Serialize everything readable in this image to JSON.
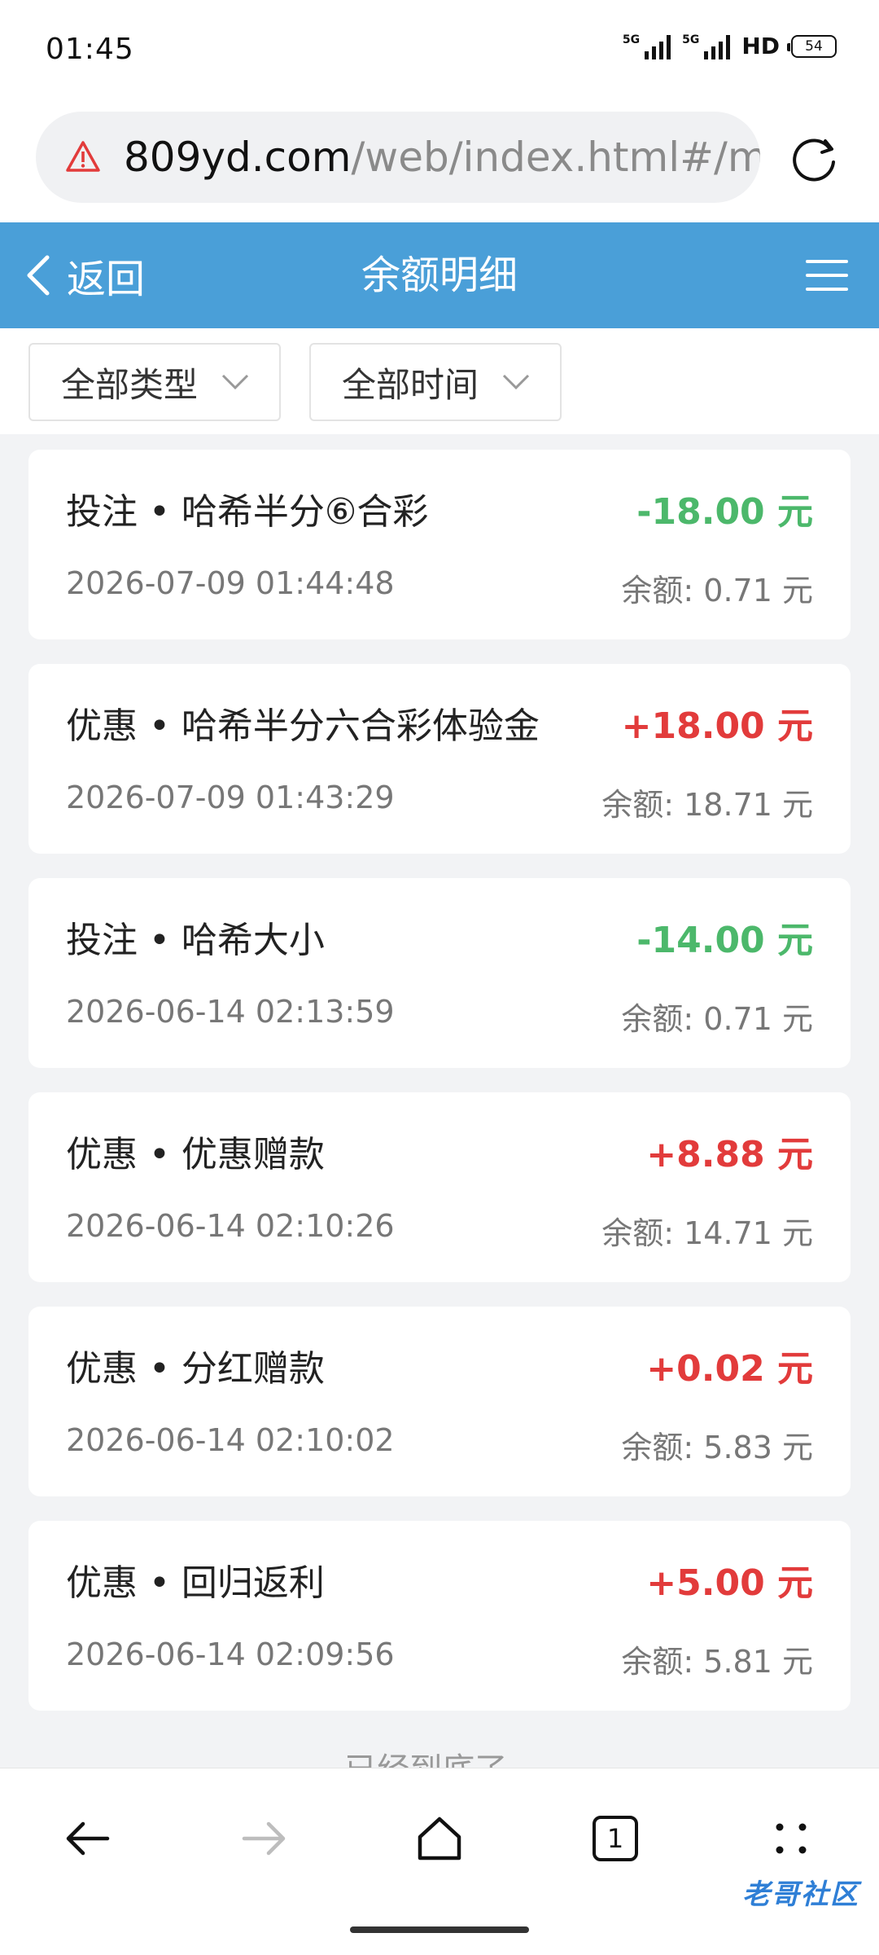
{
  "status_bar": {
    "time": "01:45",
    "network_1": "5G",
    "network_2": "5G",
    "hd_label": "HD",
    "battery": "54"
  },
  "browser": {
    "url_domain": "809yd.com",
    "url_path": "/web/index.html#/my",
    "warning_icon": "warning-triangle-icon",
    "reload_icon": "reload-icon"
  },
  "header": {
    "back_label": "返回",
    "title": "余额明细",
    "accent_color": "#4a9fd8"
  },
  "filters": {
    "type_label": "全部类型",
    "time_label": "全部时间"
  },
  "records": [
    {
      "title": "投注 • 哈希半分⑥合彩",
      "amount": "-18.00 元",
      "time": "2026-07-09 01:44:48",
      "balance": "余额: 0.71 元",
      "sign": "negative"
    },
    {
      "title": "优惠 • 哈希半分六合彩体验金",
      "amount": "+18.00 元",
      "time": "2026-07-09 01:43:29",
      "balance": "余额: 18.71 元",
      "sign": "positive"
    },
    {
      "title": "投注 • 哈希大小",
      "amount": "-14.00 元",
      "time": "2026-06-14 02:13:59",
      "balance": "余额: 0.71 元",
      "sign": "negative"
    },
    {
      "title": "优惠 • 优惠赠款",
      "amount": "+8.88 元",
      "time": "2026-06-14 02:10:26",
      "balance": "余额: 14.71 元",
      "sign": "positive"
    },
    {
      "title": "优惠 • 分红赠款",
      "amount": "+0.02 元",
      "time": "2026-06-14 02:10:02",
      "balance": "余额: 5.83 元",
      "sign": "positive"
    },
    {
      "title": "优惠 • 回归返利",
      "amount": "+5.00 元",
      "time": "2026-06-14 02:09:56",
      "balance": "余额: 5.81 元",
      "sign": "positive"
    }
  ],
  "colors": {
    "negative": "#4cb86b",
    "positive": "#e23b3b"
  },
  "footer_note": "已经到底了~",
  "bottom_nav": {
    "tab_count": "1",
    "icons": [
      "back-arrow-icon",
      "forward-arrow-icon",
      "home-icon",
      "tabs-icon",
      "more-icon"
    ]
  },
  "watermark": "老哥社区"
}
